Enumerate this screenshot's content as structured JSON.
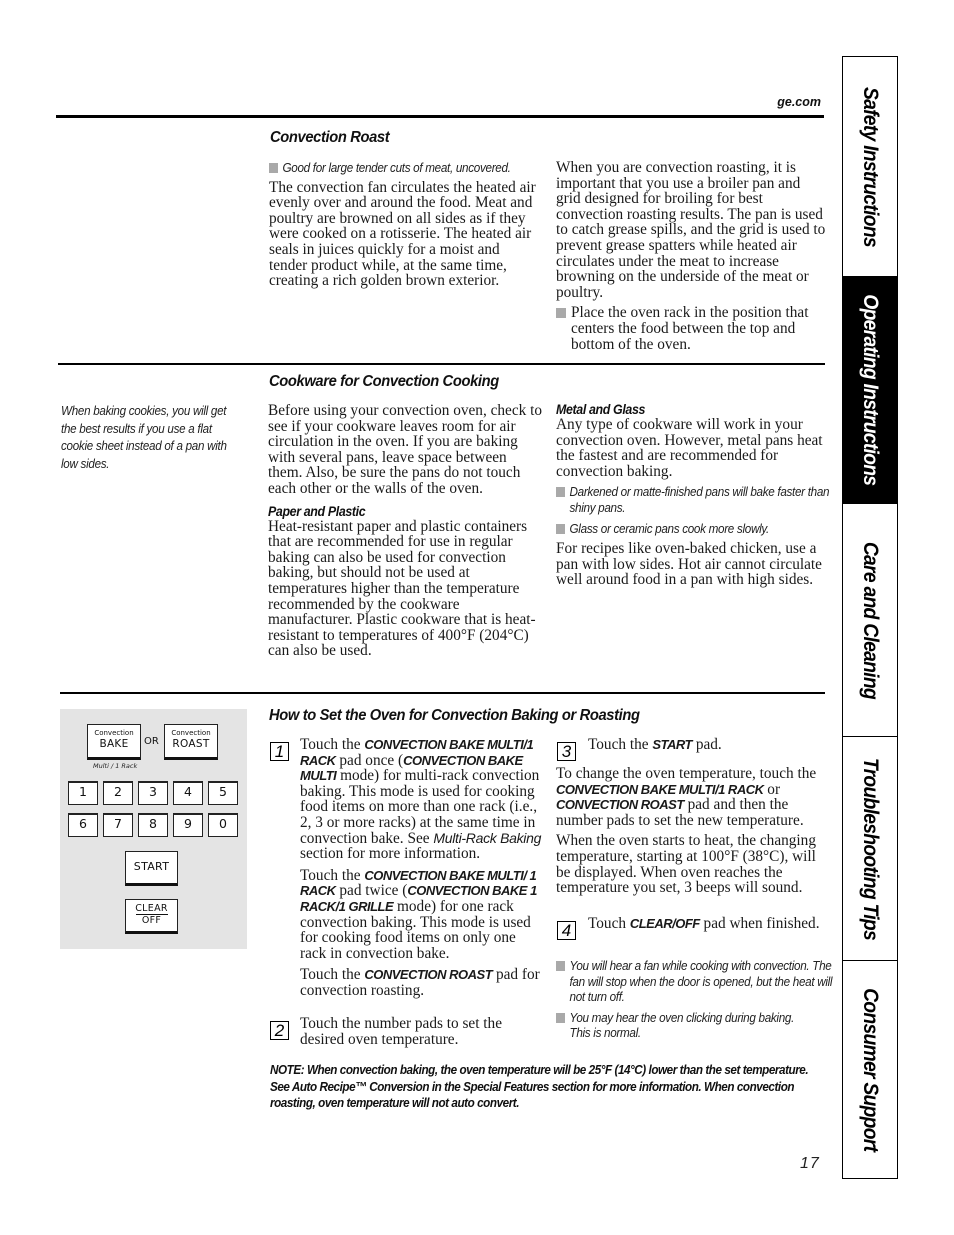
{
  "header": {
    "site": "ge.com"
  },
  "side_tabs": [
    {
      "label": "Safety Instructions",
      "active": false
    },
    {
      "label": "Operating Instructions",
      "active": true
    },
    {
      "label": "Care and Cleaning",
      "active": false
    },
    {
      "label": "Troubleshooting Tips",
      "active": false
    },
    {
      "label": "Consumer Support",
      "active": false
    }
  ],
  "convection_roast": {
    "title": "Convection Roast",
    "bullet": "Good for large tender cuts of meat, uncovered.",
    "left_paragraph": "The convection fan circulates the heated air evenly over and around the food. Meat and poultry are browned on all sides as if they were cooked on a rotisserie. The heated air seals in juices quickly for a moist and tender product while, at the same time, creating a rich golden brown exterior.",
    "right_paragraph": "When you are convection roasting, it is important that you use a broiler pan and grid designed for broiling for best convection roasting results. The pan is used to catch grease spills, and the grid is used to prevent grease spatters while heated air circulates under the meat to increase browning on the underside of the meat or poultry.",
    "right_bullet": "Place the oven rack in the position that centers the food between the top and bottom of the oven."
  },
  "cookware": {
    "title": "Cookware for Convection Cooking",
    "side_note": "When baking cookies, you will get the best results if you use a flat cookie sheet instead of a pan with low sides.",
    "intro": "Before using your convection oven, check to see if your cookware leaves room for air circulation in the oven. If you are baking with several pans, leave space between them. Also, be sure the pans do not touch each other or the walls of the oven.",
    "paper_title": "Paper and Plastic",
    "paper_text": "Heat-resistant paper and plastic containers that are recommended for use in regular baking can also be used for convection baking, but should not be used at temperatures higher than the temperature recommended by the cookware manufacturer. Plastic cookware that is heat-resistant to temperatures of 400°F (204°C) can also be used.",
    "metal_title": "Metal and Glass",
    "metal_text": "Any type of cookware will work in your convection oven. However, metal pans heat the fastest and are recommended for convection baking.",
    "metal_bullets": [
      "Darkened or matte-finished pans will bake faster than shiny pans.",
      "Glass or ceramic pans cook more slowly."
    ],
    "metal_closing": "For recipes like oven-baked chicken, use a pan with low sides. Hot air cannot circulate well around food in a pan with high sides."
  },
  "control_panel": {
    "bake_small": "Convection",
    "bake_big": "BAKE",
    "or_label": "OR",
    "roast_small": "Convection",
    "roast_big": "ROAST",
    "multi_label": "Multi / 1 Rack",
    "number_pads": [
      "1",
      "2",
      "3",
      "4",
      "5",
      "6",
      "7",
      "8",
      "9",
      "0"
    ],
    "start_label": "START",
    "clear_label": "CLEAR",
    "off_label": "OFF"
  },
  "how_to": {
    "title": "How to Set the Oven for Convection Baking or Roasting",
    "steps": [
      {
        "number": "1",
        "p1": {
          "a": "Touch the ",
          "b": "CONVECTION BAKE MULTI/1 RACK",
          "c": " pad once (",
          "d": "CONVECTION BAKE MULTI",
          "e": " mode) for multi-rack convection baking. This mode is used for cooking food items on more than one rack (i.e., 2, 3 or more racks) at the same time in convection bake. See ",
          "f": "Multi-Rack Baking",
          "g": " section for more information."
        },
        "p2": {
          "a": "Touch the ",
          "b": "CONVECTION BAKE MULTI/ 1 RACK",
          "c": " pad twice (",
          "d": "CONVECTION BAKE 1 RACK/1 GRILLE",
          "e": " mode) for one rack convection baking. This mode is used for cooking food items on only one rack in convection bake."
        },
        "p3": {
          "a": "Touch the ",
          "b": "CONVECTION ROAST",
          "c": " pad for convection roasting."
        }
      },
      {
        "number": "2",
        "text": "Touch the number pads to set the desired oven temperature."
      },
      {
        "number": "3",
        "a": "Touch the ",
        "b": "START",
        "c": " pad."
      },
      {
        "number": "4",
        "a": "Touch ",
        "b": "CLEAR/OFF",
        "c": " pad when finished."
      }
    ],
    "change_temp": {
      "a": "To change the oven temperature, touch the ",
      "b": "CONVECTION BAKE MULTI/1 RACK",
      "c": " or ",
      "d": "CONVECTION ROAST",
      "e": " pad and then the number pads to set the new temperature."
    },
    "heat_text": "When the oven starts to heat, the changing temperature, starting at 100°F (38°C), will be displayed. When oven reaches the temperature you set, 3 beeps will sound.",
    "notes": [
      "You will hear a fan while cooking with convection. The fan will stop when the door is opened, but the heat will not turn off.",
      "You may hear the oven clicking during baking. This is normal."
    ],
    "bottom_note": "NOTE: When convection baking, the oven temperature will be 25°F (14°C) lower than the set temperature. See Auto Recipe™ Conversion in the Special Features section for more information. When convection roasting, oven temperature will not auto convert."
  },
  "footer": {
    "page_number": "17"
  }
}
